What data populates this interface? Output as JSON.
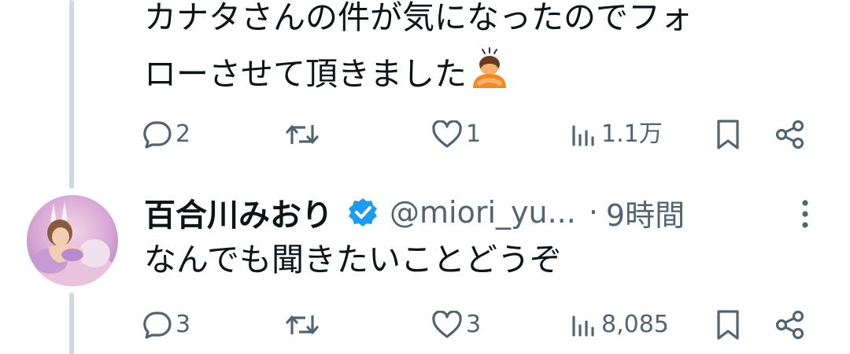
{
  "post1": {
    "text_line1": "カナタさんの件が気になったのでフォ",
    "text_line2": "ローさせて頂きました",
    "emoji": "person-bowing-emoji",
    "reply_count": "2",
    "repost_count": "",
    "like_count": "1",
    "view_count": "1.1万"
  },
  "post2": {
    "display_name": "百合川みおり",
    "handle": "@miori_yu...",
    "separator": "·",
    "timestamp": "9時間",
    "text": "なんでも聞きたいことどうぞ",
    "reply_count": "3",
    "repost_count": "",
    "like_count": "3",
    "view_count": "8,085"
  },
  "icons": {
    "reply": "speech-bubble-icon",
    "repost": "repost-arrows-icon",
    "like": "heart-icon",
    "views": "bar-chart-icon",
    "bookmark": "bookmark-icon",
    "share": "share-icon",
    "verified": "verified-badge-icon",
    "more": "more-vertical-icon"
  },
  "colors": {
    "text_primary": "#0f1419",
    "text_secondary": "#536471",
    "verified_blue": "#1d9bf0",
    "thread_line": "#cfd9de",
    "background": "#ffffff"
  }
}
